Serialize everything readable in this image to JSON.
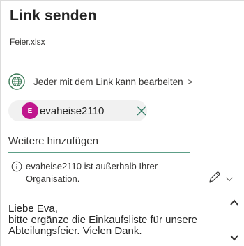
{
  "dialog": {
    "title": "Link senden",
    "filename": "Feier.xlsx"
  },
  "permission": {
    "icon": "globe-icon",
    "text": "Jeder mit dem Link kann bearbeiten",
    "chevron": ">"
  },
  "recipient": {
    "initial": "E",
    "name": "evaheise2110",
    "avatar_color": "#c0168d",
    "remove_icon": "close-icon"
  },
  "add_more": {
    "placeholder": "Weitere hinzufügen"
  },
  "warning": {
    "icon": "info-icon",
    "text": "evaheise2110 ist außerhalb Ihrer Organisation."
  },
  "message": {
    "text": "Liebe Eva,\nbitte ergänze die Einkaufsliste für unsere Abteilungsfeier. Vielen Dank."
  },
  "colors": {
    "accent_underline": "#5d9e87",
    "globe": "#3b7a57"
  }
}
